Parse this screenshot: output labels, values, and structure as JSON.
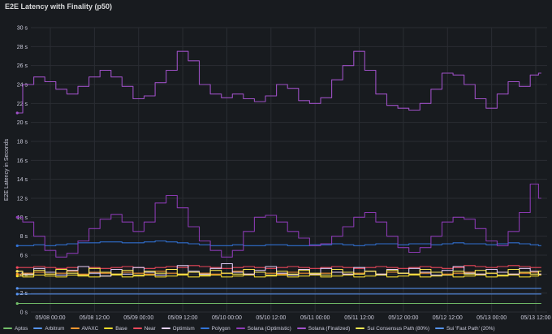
{
  "panel": {
    "title": "E2E Latency with Finality (p50)"
  },
  "chart_data": {
    "type": "line",
    "title": "E2E Latency with Finality (p50)",
    "xlabel": "",
    "ylabel": "E2E Latency in Seconds",
    "ylim": [
      0,
      30
    ],
    "y_ticks": [
      "0 s",
      "2 s",
      "4 s",
      "6 s",
      "8 s",
      "10 s",
      "12 s",
      "14 s",
      "16 s",
      "18 s",
      "20 s",
      "22 s",
      "24 s",
      "26 s",
      "28 s",
      "30 s"
    ],
    "x_ticks": [
      "05/08 00:00",
      "05/08 12:00",
      "05/09 00:00",
      "05/09 12:00",
      "05/10 00:00",
      "05/10 12:00",
      "05/11 00:00",
      "05/11 12:00",
      "05/12 00:00",
      "05/12 12:00",
      "05/13 00:00",
      "05/13 12:00"
    ],
    "grid": true,
    "legend_position": "bottom",
    "x": [
      "05/07 15:00",
      "05/07 18:00",
      "05/07 21:00",
      "05/08 00:00",
      "05/08 03:00",
      "05/08 06:00",
      "05/08 09:00",
      "05/08 12:00",
      "05/08 15:00",
      "05/08 18:00",
      "05/08 21:00",
      "05/09 00:00",
      "05/09 03:00",
      "05/09 06:00",
      "05/09 09:00",
      "05/09 12:00",
      "05/09 15:00",
      "05/09 18:00",
      "05/09 21:00",
      "05/10 00:00",
      "05/10 03:00",
      "05/10 06:00",
      "05/10 09:00",
      "05/10 12:00",
      "05/10 15:00",
      "05/10 18:00",
      "05/10 21:00",
      "05/11 00:00",
      "05/11 03:00",
      "05/11 06:00",
      "05/11 09:00",
      "05/11 12:00",
      "05/11 15:00",
      "05/11 18:00",
      "05/11 21:00",
      "05/12 00:00",
      "05/12 03:00",
      "05/12 06:00",
      "05/12 09:00",
      "05/12 12:00",
      "05/12 15:00",
      "05/12 18:00",
      "05/12 21:00",
      "05/13 00:00",
      "05/13 03:00",
      "05/13 06:00",
      "05/13 09:00",
      "05/13 12:00",
      "05/13 13:30"
    ],
    "series": [
      {
        "name": "Aptos",
        "color": "#73bf69",
        "values": [
          0.9,
          0.9,
          0.9,
          0.9,
          0.9,
          0.9,
          0.9,
          0.9,
          0.9,
          0.9,
          0.9,
          0.9,
          0.9,
          0.9,
          0.9,
          0.9,
          0.9,
          0.9,
          0.9,
          0.9,
          0.9,
          0.9,
          0.9,
          0.9,
          0.9,
          0.9,
          0.9,
          0.9,
          0.9,
          0.9,
          0.9,
          0.9,
          0.9,
          0.9,
          0.9,
          0.9,
          0.9,
          0.9,
          0.9,
          0.9,
          0.9,
          0.9,
          0.9,
          0.9,
          0.9,
          0.9,
          0.9,
          0.9,
          0.9
        ]
      },
      {
        "name": "Arbitrum",
        "color": "#5794f2",
        "values": [
          2.5,
          2.5,
          2.5,
          2.5,
          2.5,
          2.5,
          2.5,
          2.5,
          2.5,
          2.5,
          2.5,
          2.5,
          2.5,
          2.5,
          2.5,
          2.5,
          2.5,
          2.5,
          2.5,
          2.5,
          2.5,
          2.5,
          2.5,
          2.5,
          2.5,
          2.5,
          2.5,
          2.5,
          2.5,
          2.5,
          2.5,
          2.5,
          2.5,
          2.5,
          2.5,
          2.5,
          2.5,
          2.5,
          2.5,
          2.5,
          2.5,
          2.5,
          2.5,
          2.5,
          2.5,
          2.5,
          2.5,
          2.5,
          2.5
        ]
      },
      {
        "name": "AVAXC",
        "color": "#ff9830",
        "values": [
          4.0,
          4.1,
          4.2,
          4.0,
          4.1,
          4.3,
          4.0,
          4.2,
          4.1,
          4.0,
          4.2,
          4.1,
          4.0,
          4.3,
          4.1,
          4.0,
          4.2,
          4.1,
          4.0,
          4.1,
          4.3,
          4.0,
          4.2,
          4.1,
          4.0,
          4.2,
          4.1,
          4.0,
          4.1,
          4.2,
          4.0,
          4.1,
          4.3,
          4.0,
          4.2,
          4.1,
          4.0,
          4.1,
          4.2,
          4.0,
          4.1,
          4.2,
          4.0,
          4.1,
          4.2,
          4.0,
          4.1,
          4.2,
          4.0
        ]
      },
      {
        "name": "Base",
        "color": "#fade2a",
        "values": [
          3.8,
          3.7,
          3.9,
          3.8,
          3.7,
          3.9,
          3.8,
          3.7,
          3.8,
          3.9,
          3.7,
          3.8,
          3.9,
          3.7,
          3.8,
          3.9,
          3.7,
          3.8,
          3.9,
          3.7,
          3.8,
          3.9,
          3.7,
          3.8,
          3.9,
          3.7,
          3.8,
          3.9,
          3.7,
          3.8,
          3.9,
          3.7,
          3.8,
          3.9,
          3.7,
          3.8,
          3.9,
          3.7,
          3.8,
          3.9,
          3.7,
          3.8,
          3.9,
          3.7,
          3.8,
          3.9,
          3.7,
          3.8,
          3.9
        ]
      },
      {
        "name": "Near",
        "color": "#f2495c",
        "values": [
          4.7,
          4.7,
          4.8,
          4.7,
          4.6,
          4.7,
          4.8,
          4.7,
          4.6,
          4.7,
          4.8,
          4.7,
          4.6,
          4.7,
          4.8,
          4.7,
          4.9,
          4.8,
          4.7,
          4.6,
          4.7,
          4.8,
          4.7,
          4.6,
          4.7,
          4.8,
          4.7,
          4.6,
          4.7,
          4.8,
          4.7,
          4.6,
          4.7,
          4.8,
          4.7,
          4.6,
          4.7,
          4.8,
          4.7,
          4.6,
          4.7,
          4.9,
          4.8,
          4.7,
          4.8,
          4.9,
          4.8,
          4.7,
          4.7
        ]
      },
      {
        "name": "Optimism",
        "color": "#e8d3ff",
        "values": [
          4.3,
          4.0,
          4.6,
          4.2,
          3.9,
          4.4,
          4.8,
          4.1,
          3.8,
          4.5,
          4.0,
          4.7,
          4.2,
          3.9,
          4.5,
          4.9,
          4.3,
          4.0,
          4.6,
          5.1,
          4.2,
          4.0,
          4.4,
          4.8,
          4.1,
          3.9,
          4.5,
          4.0,
          4.6,
          4.2,
          4.0,
          4.7,
          4.3,
          4.0,
          4.5,
          4.1,
          4.6,
          4.2,
          3.9,
          4.4,
          4.8,
          4.1,
          4.0,
          4.5,
          4.2,
          4.0,
          4.6,
          4.3,
          4.0
        ]
      },
      {
        "name": "Polygon",
        "color": "#3274d9",
        "values": [
          7.0,
          7.0,
          7.1,
          7.0,
          7.1,
          7.2,
          7.3,
          7.3,
          7.4,
          7.4,
          7.3,
          7.3,
          7.4,
          7.5,
          7.4,
          7.3,
          7.2,
          7.1,
          7.0,
          7.0,
          7.1,
          7.0,
          7.0,
          7.1,
          7.1,
          7.0,
          7.0,
          7.1,
          7.1,
          7.2,
          7.1,
          7.0,
          7.1,
          7.2,
          7.2,
          7.1,
          7.2,
          7.2,
          7.1,
          7.2,
          7.3,
          7.2,
          7.2,
          7.1,
          7.2,
          7.3,
          7.2,
          7.1,
          7.0
        ]
      },
      {
        "name": "Solana (Optimistic)",
        "color": "#8f3bb8",
        "values": [
          10.0,
          9.5,
          8.0,
          6.5,
          5.8,
          6.2,
          7.5,
          8.8,
          9.8,
          10.3,
          9.5,
          8.5,
          9.5,
          11.5,
          12.3,
          11.0,
          9.0,
          7.5,
          6.5,
          5.8,
          6.5,
          8.5,
          10.0,
          10.2,
          9.5,
          8.5,
          7.8,
          7.0,
          7.2,
          8.0,
          9.0,
          10.0,
          10.5,
          9.5,
          8.0,
          6.8,
          6.3,
          6.8,
          8.0,
          9.5,
          10.0,
          9.8,
          8.8,
          7.5,
          7.0,
          8.5,
          10.5,
          13.5,
          12.0
        ]
      },
      {
        "name": "Solana (Finalized)",
        "color": "#a352cc",
        "values": [
          21.0,
          24.0,
          24.8,
          24.3,
          23.5,
          23.0,
          23.8,
          24.8,
          25.5,
          24.8,
          23.8,
          22.5,
          22.8,
          24.2,
          25.5,
          27.5,
          26.5,
          24.0,
          23.0,
          22.6,
          23.0,
          22.5,
          22.2,
          22.8,
          24.0,
          23.6,
          22.3,
          22.0,
          22.6,
          24.5,
          26.0,
          27.5,
          25.5,
          23.0,
          21.8,
          21.5,
          21.3,
          22.0,
          23.5,
          25.2,
          25.0,
          24.0,
          22.5,
          21.5,
          23.0,
          24.3,
          23.8,
          25.0,
          25.2
        ]
      },
      {
        "name": "Sui Consensus Path (80%)",
        "color": "#ffee52",
        "values": [
          4.3,
          3.9,
          4.4,
          4.0,
          4.5,
          4.1,
          3.9,
          4.6,
          4.2,
          4.0,
          4.4,
          3.9,
          4.3,
          4.1,
          4.5,
          4.0,
          4.2,
          3.9,
          4.4,
          4.1,
          4.0,
          4.5,
          4.2,
          3.9,
          4.3,
          4.0,
          4.4,
          4.1,
          3.9,
          4.5,
          4.2,
          4.0,
          4.3,
          3.9,
          4.4,
          4.1,
          4.0,
          4.5,
          4.2,
          3.9,
          4.3,
          4.0,
          4.4,
          4.1,
          3.9,
          4.5,
          4.2,
          4.0,
          4.3
        ]
      },
      {
        "name": "Sui 'Fast Path' (20%)",
        "color": "#5794f2",
        "values": [
          1.9,
          1.9,
          1.9,
          1.9,
          1.9,
          1.9,
          1.9,
          1.9,
          1.9,
          1.9,
          1.9,
          1.9,
          1.9,
          1.9,
          1.9,
          1.9,
          1.9,
          1.9,
          1.9,
          1.9,
          1.9,
          1.9,
          1.9,
          1.9,
          1.9,
          1.9,
          1.9,
          1.9,
          1.9,
          1.9,
          1.9,
          1.9,
          1.9,
          1.9,
          1.9,
          1.9,
          1.9,
          1.9,
          1.9,
          1.9,
          1.9,
          1.9,
          1.9,
          1.9,
          1.9,
          1.9,
          1.9,
          1.9,
          1.9
        ]
      }
    ]
  }
}
